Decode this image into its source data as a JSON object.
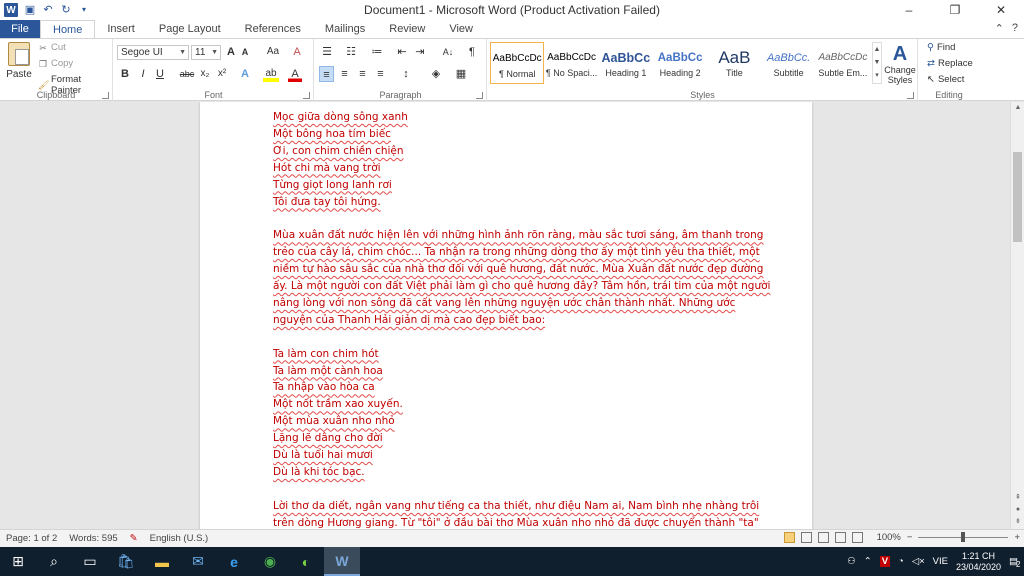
{
  "titlebar": {
    "title": "Document1 - Microsoft Word (Product Activation Failed)",
    "word_letter": "W",
    "minimize": "–",
    "restore": "❐",
    "close": "✕"
  },
  "tabs": [
    "File",
    "Home",
    "Insert",
    "Page Layout",
    "References",
    "Mailings",
    "Review",
    "View"
  ],
  "ribbon": {
    "clipboard": {
      "paste": "Paste",
      "cut": "Cut",
      "copy": "Copy",
      "format_painter": "Format Painter",
      "label": "Clipboard"
    },
    "font": {
      "family": "Segoe UI",
      "size": "11",
      "grow": "A",
      "shrink": "A",
      "change_case": "Aa",
      "clear": "A",
      "bold": "B",
      "italic": "I",
      "underline": "U",
      "strike": "abc",
      "subscript": "x₂",
      "superscript": "x²",
      "text_effects": "A",
      "highlight": "ab",
      "font_color": "A",
      "label": "Font"
    },
    "paragraph": {
      "label": "Paragraph",
      "sort": "A↓",
      "pilcrow": "¶"
    },
    "styles": {
      "label": "Styles",
      "items": [
        {
          "sample": "AaBbCcDc",
          "name": "¶ Normal"
        },
        {
          "sample": "AaBbCcDc",
          "name": "¶ No Spaci..."
        },
        {
          "sample": "AaBbCc",
          "name": "Heading 1"
        },
        {
          "sample": "AaBbCc",
          "name": "Heading 2"
        },
        {
          "sample": "AaB",
          "name": "Title"
        },
        {
          "sample": "AaBbCc.",
          "name": "Subtitle"
        },
        {
          "sample": "AaBbCcDc",
          "name": "Subtle Em..."
        }
      ],
      "change_styles": "Change Styles",
      "change_letter": "A"
    },
    "editing": {
      "find": "Find",
      "replace": "Replace",
      "select": "Select",
      "label": "Editing"
    }
  },
  "document": {
    "lines": [
      "Mọc giữa dòng sông xanh",
      "Một bông hoa tím biếc",
      "Ơi, con chim chiền chiện",
      "Hót chi mà vang trời",
      "Từng giọt long lanh rơi",
      "Tôi đưa tay tôi hứng.",
      "",
      "Mùa xuân đất nước hiện lên với những hình ảnh rõn ràng, màu sắc tươi sáng, âm thanh trong",
      "trẻo của cây lá, chim chóc... Ta nhận ra trong những dòng thơ ấy một tình yêu tha thiết, một",
      "niềm tự hào sâu sắc của nhà thơ đối với quê hương, đất nước. Mùa Xuân đất nước đẹp đường",
      "ấy. Là một người con đất Việt phải làm gì cho quê hương đây? Tâm hồn, trái tim của một người",
      "nâng lòng với non sông đã cất vang lên những nguyện ước chân thành nhất. Những ước",
      "nguyện của Thanh Hải giản dị mà cao đẹp biết bao:",
      "",
      "Ta làm con chim hót",
      "Ta làm một cành hoa",
      "Ta nhập vào hòa ca",
      "Một nốt trầm xao xuyến.",
      "Một mùa xuân nho nhỏ",
      "Lặng lẽ dâng cho đời",
      "Dù là tuổi hai mươi",
      "Dù là khi tóc bạc.",
      "",
      "Lời thơ da diết, ngân vang như tiếng ca tha thiết, như điệu Nam ai, Nam bình nhẹ nhàng trôi",
      "trên dòng Hương giang. Từ \"tôi\" ở đầu bài thơ Mùa xuân nho nhỏ đã được chuyển thành \"ta\""
    ]
  },
  "statusbar": {
    "page": "Page: 1 of 2",
    "words": "Words: 595",
    "language": "English (U.S.)",
    "zoom": "100%",
    "zoom_out": "−",
    "zoom_in": "+"
  },
  "taskbar": {
    "language": "VIE",
    "time": "1:21 CH",
    "date": "23/04/2020",
    "notifications": "2"
  },
  "colors": {
    "word_blue": "#2b579a",
    "text_red": "#c00000",
    "taskbar": "#101f2e"
  }
}
